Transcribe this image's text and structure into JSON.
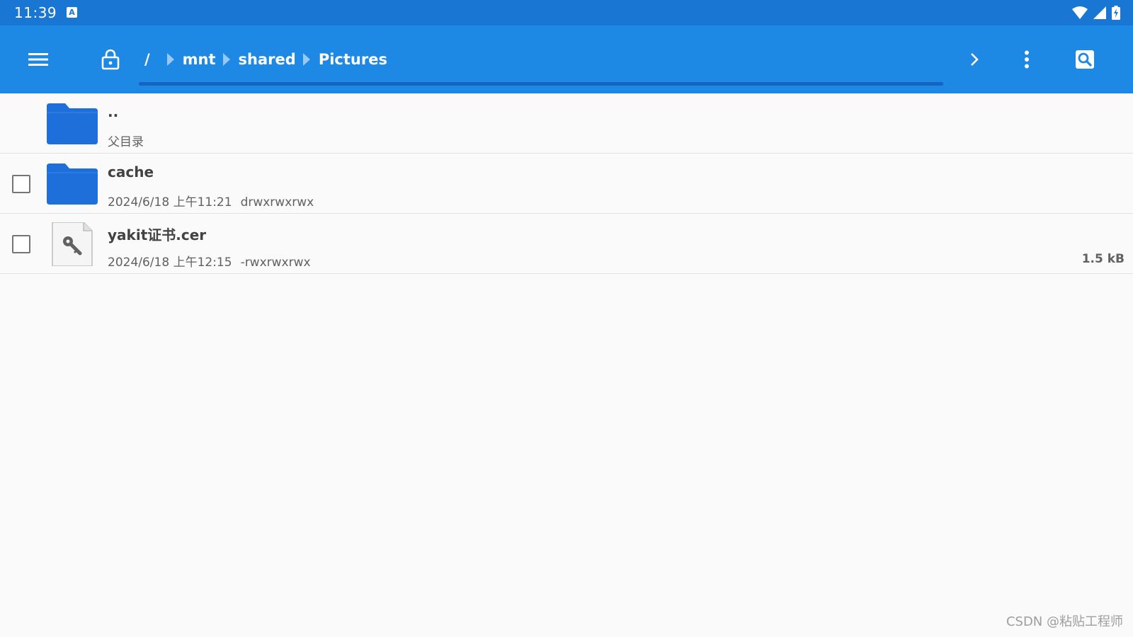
{
  "status_bar": {
    "time": "11:39",
    "notification_icon": "A",
    "icons": [
      "wifi-icon",
      "signal-icon",
      "battery-charging-icon"
    ]
  },
  "toolbar": {
    "menu_icon": "menu-icon",
    "lock_icon": "lock-open-icon",
    "breadcrumb": [
      "/",
      "mnt",
      "shared",
      "Pictures"
    ],
    "forward_icon": "chevron-right-icon",
    "more_icon": "more-vert-icon",
    "search_icon": "search-icon"
  },
  "files": [
    {
      "name": "..",
      "meta_primary": "父目录",
      "meta_secondary": "",
      "size": "",
      "type": "folder",
      "checkbox": false
    },
    {
      "name": "cache",
      "meta_primary": "2024/6/18 上午11:21",
      "meta_secondary": "drwxrwxrwx",
      "size": "",
      "type": "folder",
      "checkbox": true
    },
    {
      "name": "yakit证书.cer",
      "meta_primary": "2024/6/18 上午12:15",
      "meta_secondary": "-rwxrwxrwx",
      "size": "1.5 kB",
      "type": "certificate",
      "checkbox": true
    }
  ],
  "watermark": "CSDN @粘贴工程师",
  "colors": {
    "status_bar": "#1976d2",
    "toolbar": "#1e88e5",
    "folder": "#1e6fd9",
    "underline": "#1565c0"
  }
}
